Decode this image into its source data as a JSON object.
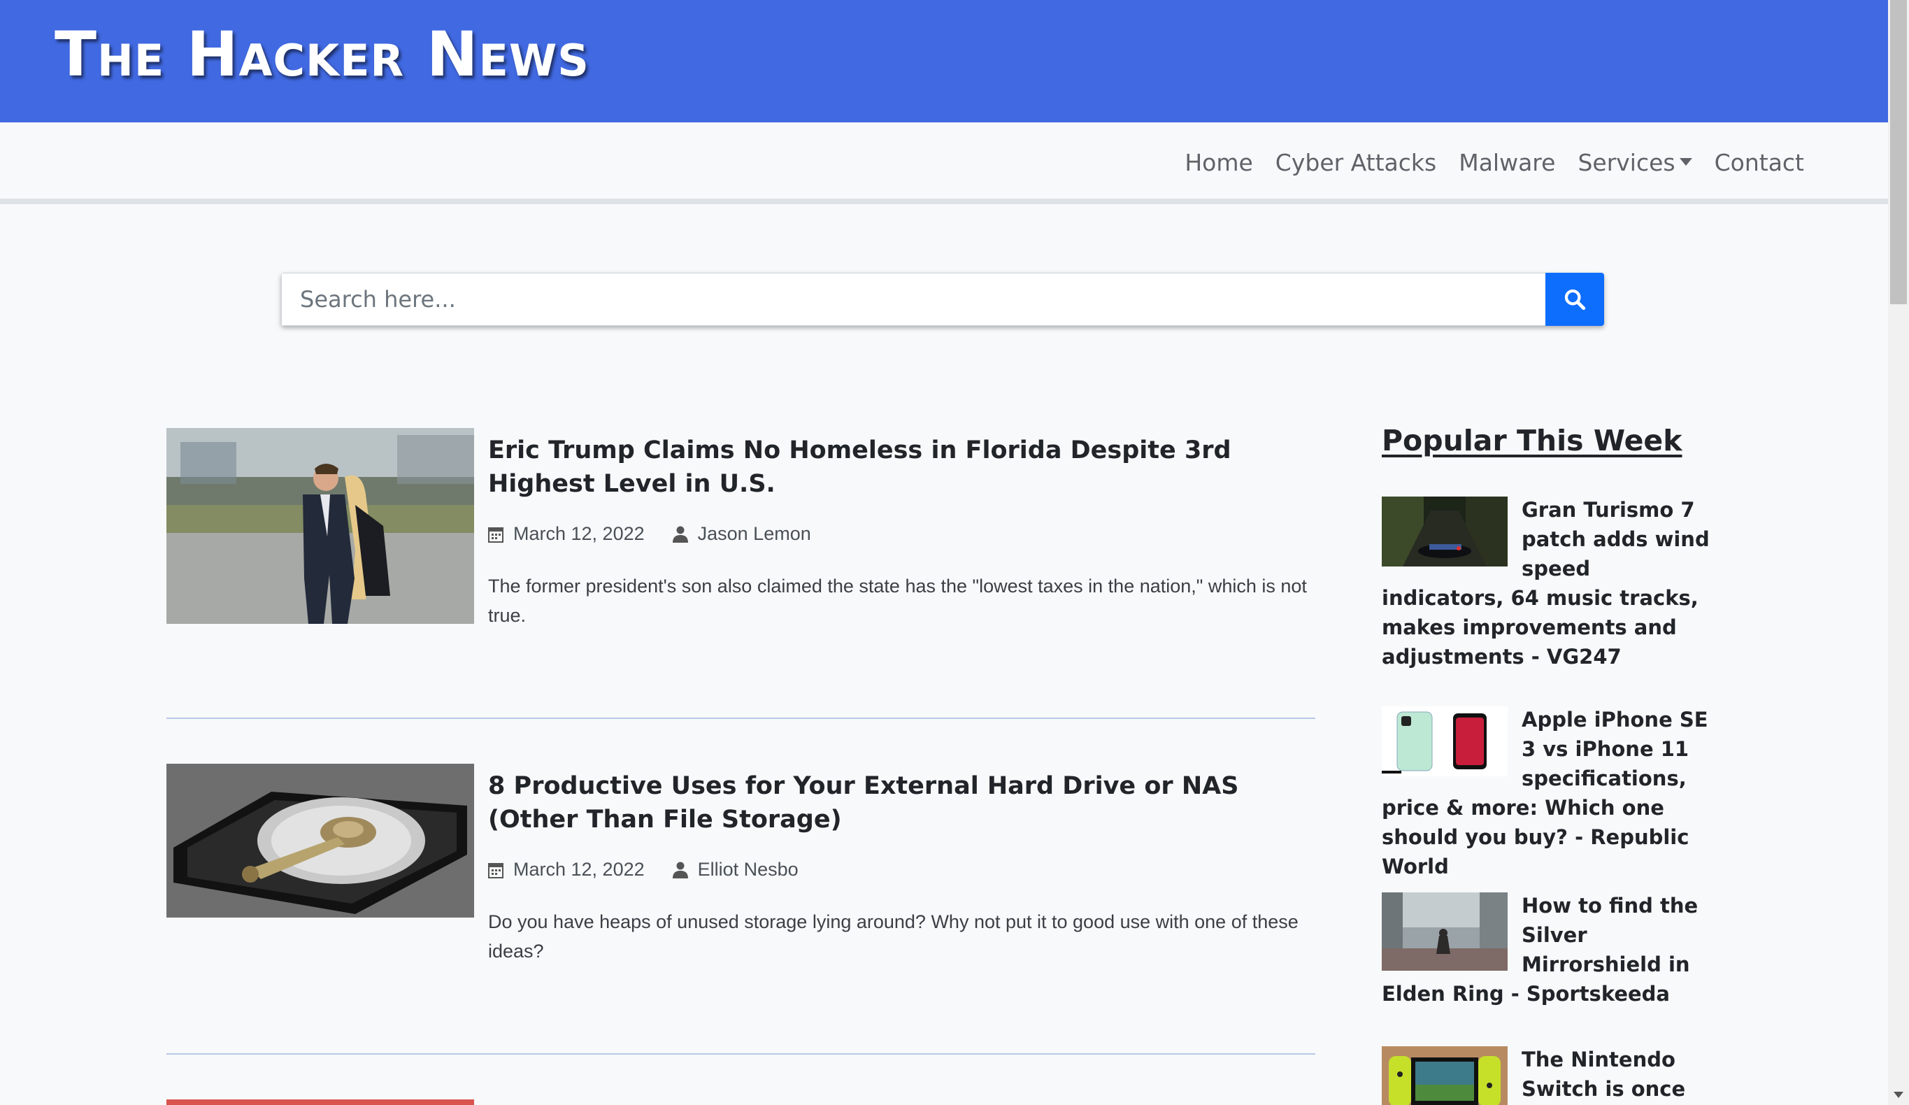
{
  "header": {
    "logo": "The Hacker News"
  },
  "nav": {
    "items": [
      {
        "label": "Home"
      },
      {
        "label": "Cyber Attacks"
      },
      {
        "label": "Malware"
      },
      {
        "label": "Services"
      },
      {
        "label": "Contact"
      }
    ]
  },
  "search": {
    "placeholder": "Search here..."
  },
  "articles": [
    {
      "title": "Eric Trump Claims No Homeless in Florida Despite 3rd Highest Level in U.S.",
      "date": "March 12, 2022",
      "author": "Jason Lemon",
      "excerpt": "The former president's son also claimed the state has the \"lowest taxes in the nation,\" which is not true."
    },
    {
      "title": "8 Productive Uses for Your External Hard Drive or NAS (Other Than File Storage)",
      "date": "March 12, 2022",
      "author": "Elliot Nesbo",
      "excerpt": "Do you have heaps of unused storage lying around? Why not put it to good use with one of these ideas?"
    }
  ],
  "sidebar": {
    "title": "Popular This Week",
    "items": [
      {
        "title": "Gran Turismo 7 patch adds wind speed indicators, 64 music tracks, makes improvements and adjustments - VG247"
      },
      {
        "title": "Apple iPhone SE 3 vs iPhone 11 specifications, price & more: Which one should you buy? - Republic World"
      },
      {
        "title": "How to find the Silver Mirrorshield in Elden Ring - Sportskeeda"
      },
      {
        "title": "The Nintendo Switch is once"
      }
    ]
  },
  "colors": {
    "header": "#4169e1",
    "search_button": "#0d6efd"
  }
}
